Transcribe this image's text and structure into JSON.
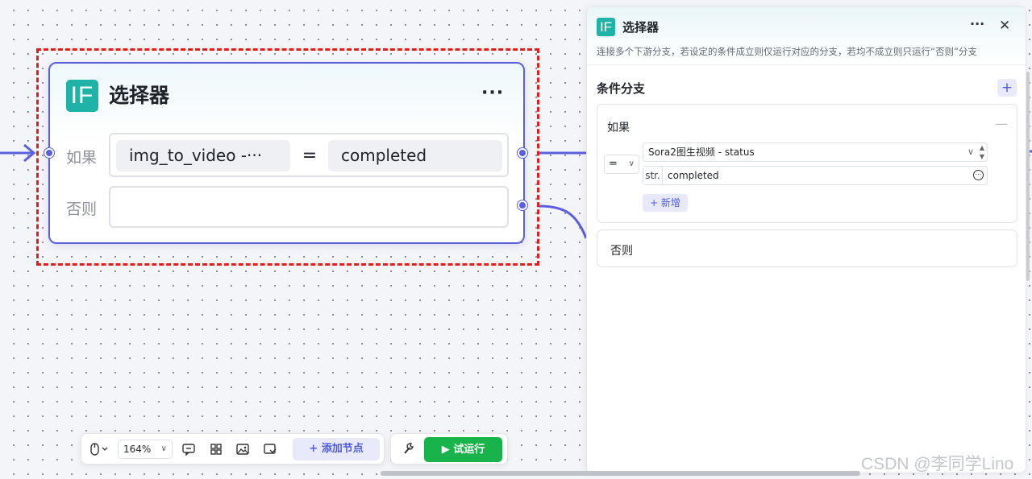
{
  "node": {
    "icon_text": "IF",
    "title": "选择器",
    "more": "···",
    "if_label": "如果",
    "else_label": "否则",
    "condition": {
      "left": "img_to_video  -···",
      "operator": "=",
      "right": "completed"
    }
  },
  "panel": {
    "icon_text": "IF",
    "title": "选择器",
    "more": "···",
    "close": "✕",
    "description": "连接多个下游分支，若设定的条件成立则仅运行对应的分支，若均不成立则只运行“否则”分支",
    "section_title": "条件分支",
    "section_add": "+",
    "if_branch": {
      "title": "如果",
      "collapse": "—",
      "operator": "=",
      "variable": "Sora2图生视频 - status",
      "value_type": "str.",
      "value": "completed",
      "add_label": "+ 新增"
    },
    "else_branch": {
      "title": "否则"
    }
  },
  "toolbar": {
    "zoom": "164%",
    "add_node": "+ 添加节点",
    "run": "▶ 试运行"
  },
  "watermark": "CSDN @李同学Lino",
  "colors": {
    "accent": "#5a5fe0",
    "if_icon": "#1fb3a7",
    "selection": "#e51c1c",
    "run": "#18b34a"
  }
}
